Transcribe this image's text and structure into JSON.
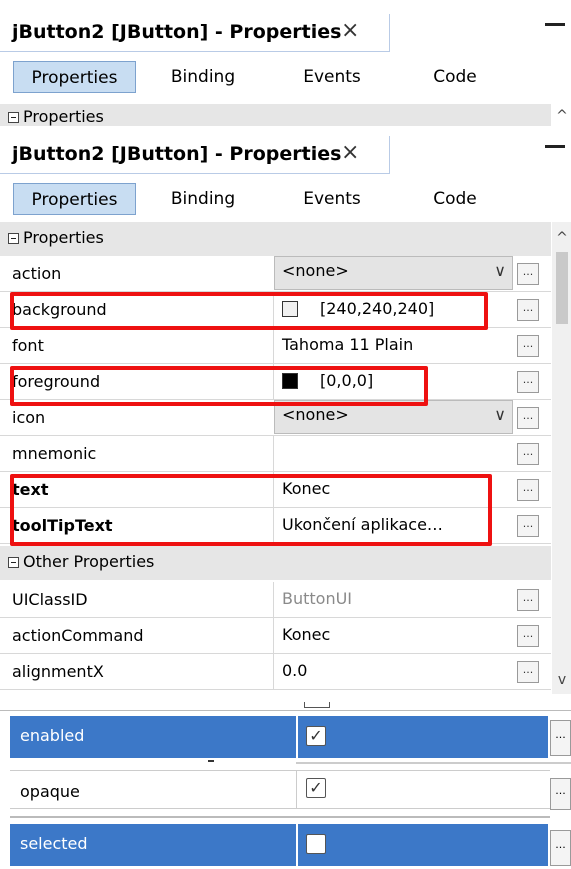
{
  "window": {
    "title": "jButton2 [JButton] - Properties",
    "close_glyph": "×"
  },
  "tabs": [
    {
      "label": "Properties",
      "active": true
    },
    {
      "label": "Binding",
      "active": false
    },
    {
      "label": "Events",
      "active": false
    },
    {
      "label": "Code",
      "active": false
    }
  ],
  "categories": {
    "properties": "Properties",
    "other": "Other Properties"
  },
  "properties": [
    {
      "name": "action",
      "value": "<none>",
      "editor": "combo"
    },
    {
      "name": "background",
      "value": "[240,240,240]",
      "swatch": "#f0f0f0"
    },
    {
      "name": "font",
      "value": "Tahoma 11 Plain"
    },
    {
      "name": "foreground",
      "value": "[0,0,0]",
      "swatch": "#000000"
    },
    {
      "name": "icon",
      "value": "<none>",
      "editor": "combo"
    },
    {
      "name": "mnemonic",
      "value": ""
    },
    {
      "name": "text",
      "value": "Konec",
      "bold": true
    },
    {
      "name": "toolTipText",
      "value": "Ukončení aplikace…",
      "bold": true
    }
  ],
  "other_properties": [
    {
      "name": "UIClassID",
      "value": "ButtonUI",
      "readonly": true
    },
    {
      "name": "actionCommand",
      "value": "Konec"
    },
    {
      "name": "alignmentX",
      "value": "0.0"
    }
  ],
  "snippets": [
    {
      "name": "enabled",
      "checked": true,
      "selected": true
    },
    {
      "name": "opaque",
      "checked": true,
      "selected": false
    },
    {
      "name": "selected",
      "checked": false,
      "selected": true
    }
  ],
  "custom_editor_glyph": "...",
  "check_glyph": "✓",
  "icons": {
    "close": "close-icon",
    "minimize": "minimize-icon",
    "collapse": "collapse-icon",
    "dropdown": "chevron-down-icon",
    "scroll_up": "scroll-up-icon",
    "scroll_down": "scroll-down-icon"
  },
  "colors": {
    "selection": "#3c78c8",
    "highlight_box": "#ee1111",
    "active_tab": "#c8ddf2",
    "category_bg": "#e6e6e6"
  }
}
